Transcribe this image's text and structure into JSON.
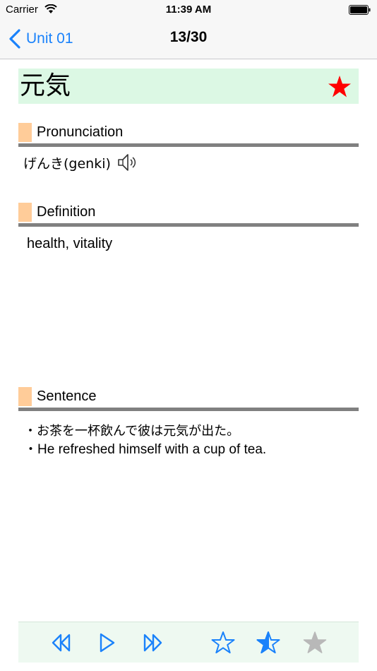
{
  "status": {
    "carrier": "Carrier",
    "time": "11:39 AM"
  },
  "nav": {
    "back_label": "Unit 01",
    "title": "13/30"
  },
  "word": {
    "text": "元気",
    "favorite": true
  },
  "sections": {
    "pronunciation": {
      "heading": "Pronunciation",
      "text": "げんき(genki)"
    },
    "definition": {
      "heading": "Definition",
      "text": "health, vitality"
    },
    "sentence": {
      "heading": "Sentence",
      "lines": [
        "・お茶を一杯飲んで彼は元気が出た。",
        "・He refreshed himself with a cup of tea."
      ]
    }
  },
  "colors": {
    "accent": "#1a82fb",
    "star_active": "#ff0000",
    "star_disabled": "#b8b8b8",
    "header_bg": "#dcf8e4",
    "marker": "#ffcc99",
    "rule": "#808080"
  },
  "toolbar": {
    "icons": [
      "rewind-icon",
      "play-icon",
      "fast-forward-icon",
      "star-outline-icon",
      "star-filled-icon",
      "star-gray-icon"
    ]
  }
}
